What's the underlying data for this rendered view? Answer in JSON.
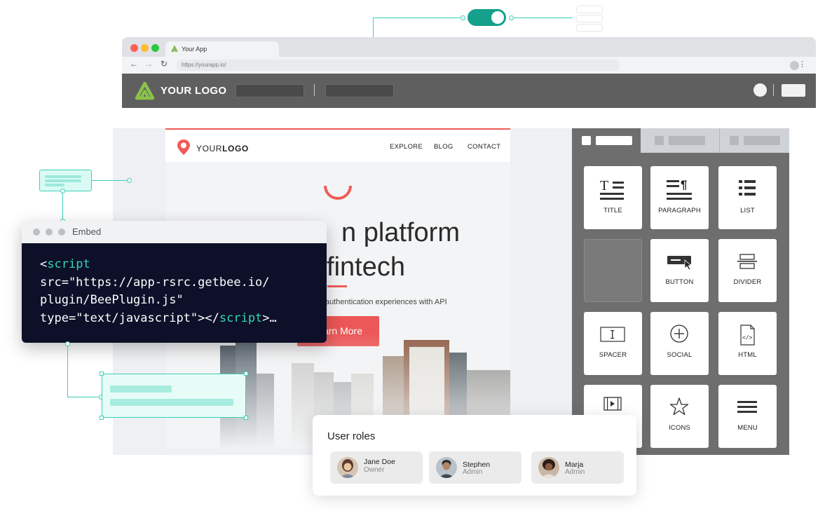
{
  "browser": {
    "tab_title": "Your App",
    "url": "https://yourapp.io/",
    "nav_back": "←",
    "nav_forward": "→",
    "nav_reload": "↻",
    "menu_glyph": "⋮"
  },
  "app_bar": {
    "logo_text": "YOUR LOGO"
  },
  "site": {
    "logo_regular": "YOUR",
    "logo_bold": "LOGO",
    "nav": [
      "EXPLORE",
      "BLOG",
      "CONTACT"
    ],
    "hero_line1": "n platform",
    "hero_line2": "fintech",
    "subtext": "authentication experiences with API",
    "cta": "arn More"
  },
  "panel": {
    "blocks": [
      {
        "label": "TITLE",
        "icon": "title-icon"
      },
      {
        "label": "PARAGRAPH",
        "icon": "paragraph-icon"
      },
      {
        "label": "LIST",
        "icon": "list-icon"
      },
      {
        "label": "",
        "icon": "empty-slot"
      },
      {
        "label": "BUTTON",
        "icon": "button-icon"
      },
      {
        "label": "DIVIDER",
        "icon": "divider-icon"
      },
      {
        "label": "SPACER",
        "icon": "spacer-icon"
      },
      {
        "label": "SOCIAL",
        "icon": "social-icon"
      },
      {
        "label": "HTML",
        "icon": "html-icon"
      },
      {
        "label": "",
        "icon": "video-icon"
      },
      {
        "label": "ICONS",
        "icon": "star-icon"
      },
      {
        "label": "MENU",
        "icon": "menu-icon"
      }
    ]
  },
  "embed": {
    "title": "Embed",
    "code": {
      "l1_open": "<",
      "l1_tag": "script",
      "l2": "src=\"https://app-rsrc.getbee.io/",
      "l3": "plugin/BeePlugin.js\"",
      "l4_a": "type=\"text/javascript\"></",
      "l4_tag": "script",
      "l4_b": ">…"
    }
  },
  "user_roles": {
    "title": "User roles",
    "users": [
      {
        "name": "Jane Doe",
        "role": "Owner"
      },
      {
        "name": "Stephen",
        "role": "Admin"
      },
      {
        "name": "Marja",
        "role": "Admin"
      }
    ]
  },
  "colors": {
    "accent": "#3ccfb6",
    "toggle": "#14a08a",
    "brand_red": "#ec5757",
    "code_bg": "#0d1028",
    "app_bar": "#5f5f5f"
  },
  "toggle": {
    "state": "on"
  }
}
